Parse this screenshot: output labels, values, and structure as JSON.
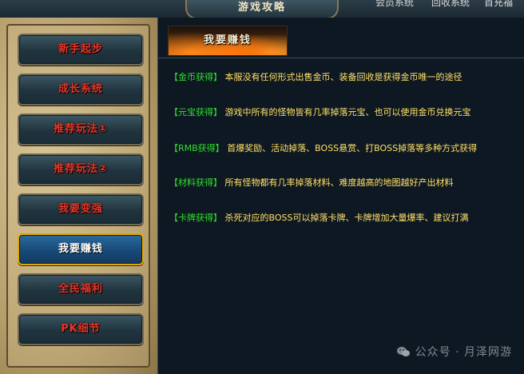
{
  "header": {
    "title": "游戏攻略",
    "cut_left": "会员系统",
    "cut_mid": "回收系统",
    "cut_right": "首充福"
  },
  "sidebar": {
    "items": [
      {
        "label": "新手起步",
        "active": false
      },
      {
        "label": "成长系统",
        "active": false
      },
      {
        "label": "推荐玩法①",
        "active": false
      },
      {
        "label": "推荐玩法②",
        "active": false
      },
      {
        "label": "我要变强",
        "active": false
      },
      {
        "label": "我要赚钱",
        "active": true
      },
      {
        "label": "全民福利",
        "active": false
      },
      {
        "label": "PK细节",
        "active": false
      }
    ]
  },
  "main": {
    "section_title": "我要赚钱",
    "entries": [
      {
        "label": "【金币获得】",
        "desc": "本服没有任何形式出售金币、装备回收是获得金币唯一的途径"
      },
      {
        "label": "【元宝获得】",
        "desc": "游戏中所有的怪物皆有几率掉落元宝、也可以使用金币兑换元宝"
      },
      {
        "label": "【RMB获得】",
        "desc": "首爆奖励、活动掉落、BOSS悬赏、打BOSS掉落等多种方式获得"
      },
      {
        "label": "【材料获得】",
        "desc": "所有怪物都有几率掉落材料、难度越高的地图越好产出材料"
      },
      {
        "label": "【卡牌获得】",
        "desc": "杀死对应的BOSS可以掉落卡牌、卡牌增加大量爆率、建议打满"
      }
    ]
  },
  "watermark": {
    "text": "公众号 · 月泽网游",
    "icon": "wechat-icon"
  },
  "colors": {
    "label_green": "#2ee02e",
    "desc_yellow": "#ffe066",
    "nav_text_red": "#e0382a",
    "active_border": "#e0a800"
  }
}
